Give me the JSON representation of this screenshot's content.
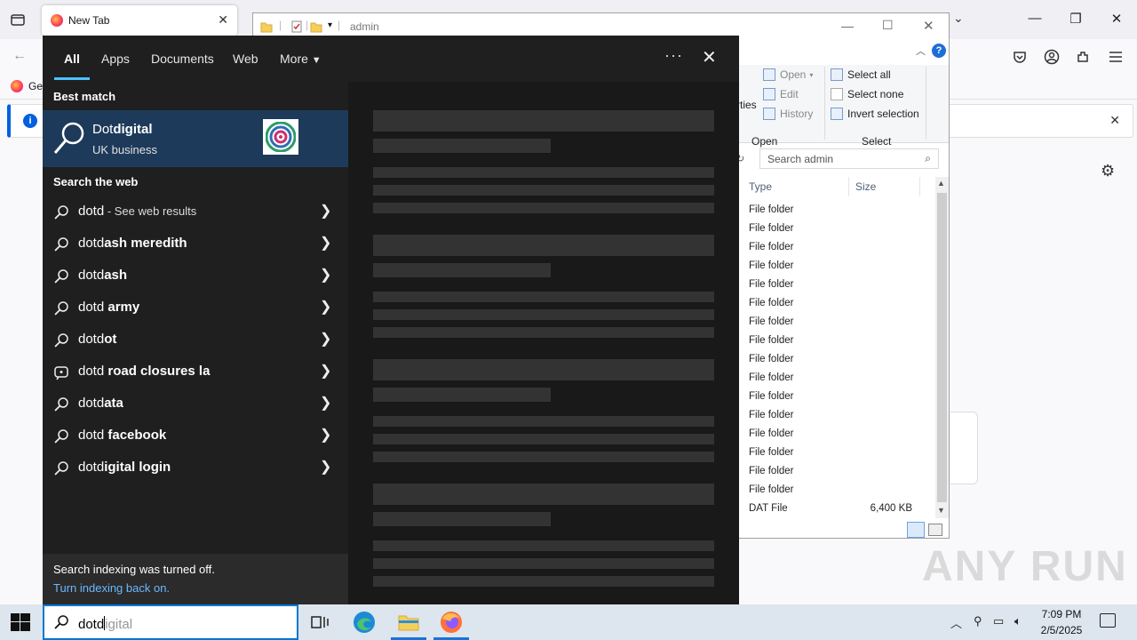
{
  "firefox": {
    "tab_title": "New Tab",
    "bookmark_label": "Get",
    "notice_close": "✕"
  },
  "explorer": {
    "address": "admin",
    "ribbon": {
      "open": "Open",
      "edit": "Edit",
      "history": "History",
      "properties_partial": "rties",
      "select_all": "Select all",
      "select_none": "Select none",
      "invert_selection": "Invert selection",
      "group_open": "Open",
      "group_select": "Select"
    },
    "search_placeholder": "Search admin",
    "columns": {
      "type": "Type",
      "size": "Size"
    },
    "rows": [
      {
        "type": "File folder",
        "size": ""
      },
      {
        "type": "File folder",
        "size": ""
      },
      {
        "type": "File folder",
        "size": ""
      },
      {
        "type": "File folder",
        "size": ""
      },
      {
        "type": "File folder",
        "size": ""
      },
      {
        "type": "File folder",
        "size": ""
      },
      {
        "type": "File folder",
        "size": ""
      },
      {
        "type": "File folder",
        "size": ""
      },
      {
        "type": "File folder",
        "size": ""
      },
      {
        "type": "File folder",
        "size": ""
      },
      {
        "type": "File folder",
        "size": ""
      },
      {
        "type": "File folder",
        "size": ""
      },
      {
        "type": "File folder",
        "size": ""
      },
      {
        "type": "File folder",
        "size": ""
      },
      {
        "type": "File folder",
        "size": ""
      },
      {
        "type": "File folder",
        "size": ""
      },
      {
        "type": "DAT File",
        "size": "6,400 KB"
      }
    ]
  },
  "search_panel": {
    "tabs": [
      "All",
      "Apps",
      "Documents",
      "Web",
      "More"
    ],
    "more_dots": "···",
    "best_match_heading": "Best match",
    "best_match": {
      "name_typed": "Dot",
      "name_rest": "digital",
      "subtitle": "UK business"
    },
    "web_heading": "Search the web",
    "suggestions": [
      {
        "typed": "dotd",
        "rest": "",
        "hint": " - See web results"
      },
      {
        "typed": "dotd",
        "rest": "ash meredith",
        "hint": ""
      },
      {
        "typed": "dotd",
        "rest": "ash",
        "hint": ""
      },
      {
        "typed": "dotd",
        "rest": " army",
        "hint": ""
      },
      {
        "typed": "dotd",
        "rest": "ot",
        "hint": ""
      },
      {
        "typed": "dotd",
        "rest": " road closures la",
        "hint": ""
      },
      {
        "typed": "dotd",
        "rest": "ata",
        "hint": ""
      },
      {
        "typed": "dotd",
        "rest": " facebook",
        "hint": ""
      },
      {
        "typed": "dotd",
        "rest": "igital login",
        "hint": ""
      }
    ],
    "footer_text": "Search indexing was turned off.",
    "footer_link": "Turn indexing back on."
  },
  "taskbar": {
    "search_typed": "dotd",
    "search_ghost": "igital",
    "time": "7:09 PM",
    "date": "2/5/2025"
  },
  "watermark": "ANY RUN",
  "colors": {
    "accent": "#4cc2ff",
    "best_match_bg": "#1e3a5a",
    "panel_bg": "#1f1f1f"
  }
}
